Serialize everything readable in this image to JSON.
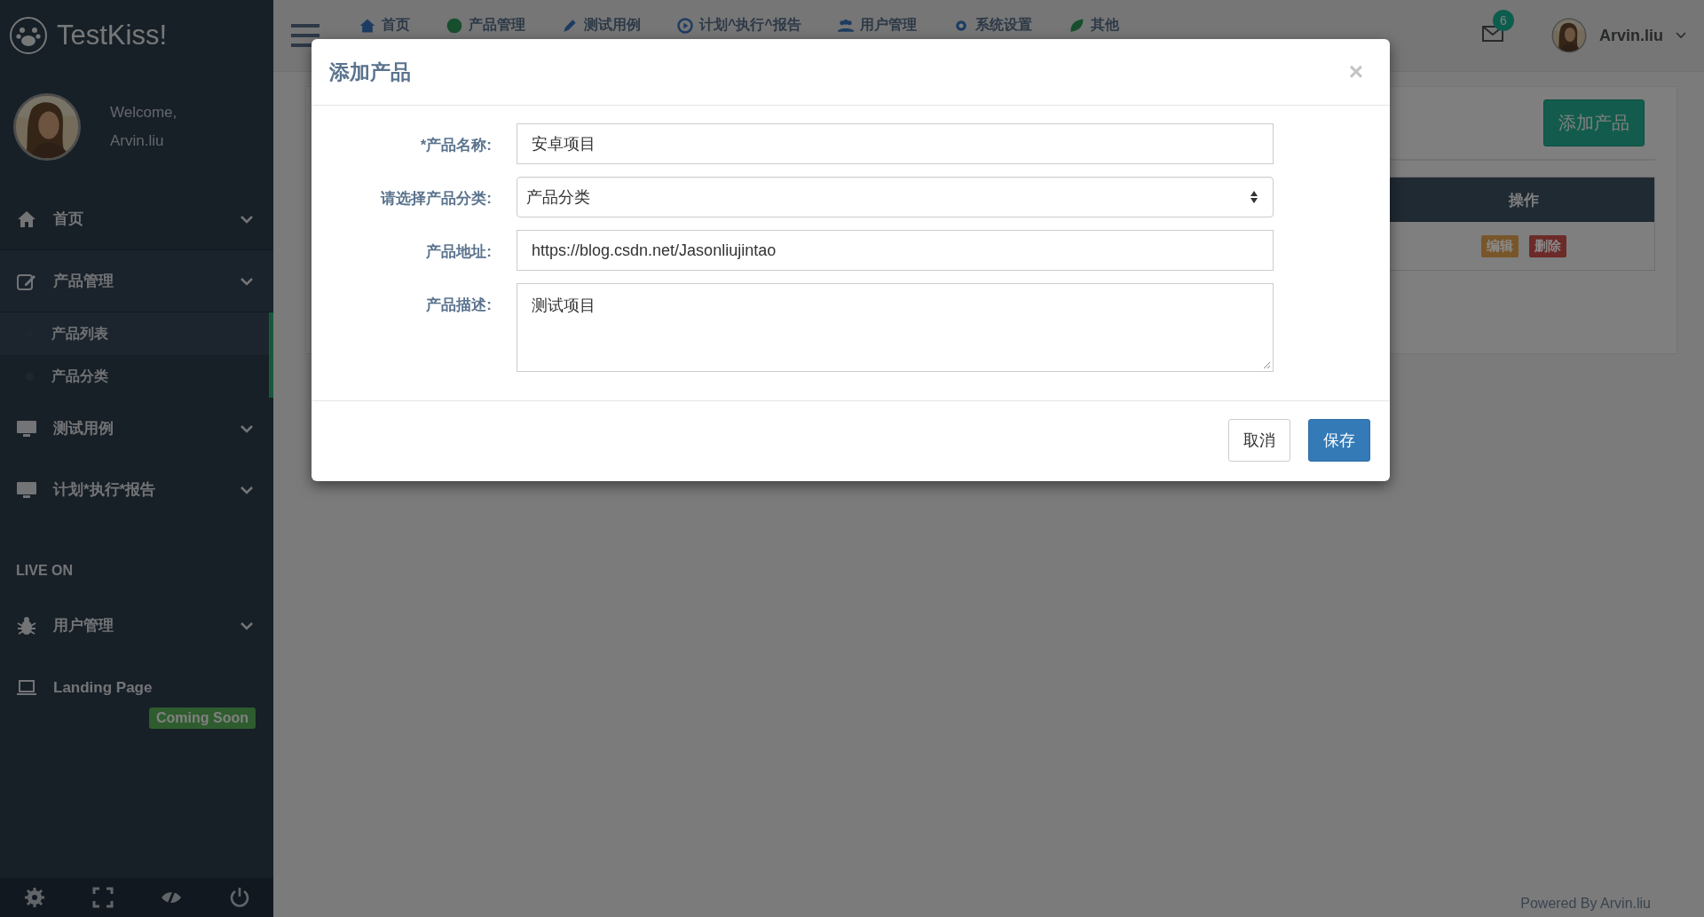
{
  "brand": {
    "name": "TestKiss!"
  },
  "profile": {
    "greeting": "Welcome,",
    "name": "Arvin.liu"
  },
  "sidebar": {
    "items": [
      {
        "label": "首页",
        "expanded": false
      },
      {
        "label": "产品管理",
        "expanded": true,
        "children": [
          {
            "label": "产品列表",
            "selected": true
          },
          {
            "label": "产品分类",
            "selected": false
          }
        ]
      },
      {
        "label": "测试用例",
        "expanded": false
      },
      {
        "label": "计划*执行*报告",
        "expanded": false
      }
    ],
    "section_title": "LIVE ON",
    "section_items": [
      {
        "label": "用户管理",
        "kind": "menu"
      },
      {
        "label": "Landing Page",
        "kind": "link",
        "badge": "Coming Soon"
      }
    ]
  },
  "topnav": [
    "首页",
    "产品管理",
    "测试用例",
    "计划^执行^报告",
    "用户管理",
    "系统设置",
    "其他"
  ],
  "header": {
    "mail_count": "6",
    "user": "Arvin.liu"
  },
  "content": {
    "add_button": "添加产品",
    "table": {
      "columns": [
        "操作"
      ],
      "rows": [
        {
          "actions": [
            {
              "label": "编辑",
              "color": "#78562a"
            },
            {
              "label": "删除",
              "color": "#6c2a28"
            }
          ]
        }
      ]
    }
  },
  "footer": "Powered By Arvin.liu",
  "modal": {
    "title": "添加产品",
    "close": "×",
    "fields": [
      {
        "label": "*产品名称:",
        "kind": "text",
        "value": "安卓项目"
      },
      {
        "label": "请选择产品分类:",
        "kind": "select",
        "value": "产品分类"
      },
      {
        "label": "产品地址:",
        "kind": "text",
        "value": "https://blog.csdn.net/Jasonliujintao"
      },
      {
        "label": "产品描述:",
        "kind": "textarea",
        "value": "测试项目"
      }
    ],
    "buttons": [
      {
        "label": "取消",
        "kind": "default"
      },
      {
        "label": "保存",
        "kind": "primary"
      }
    ]
  }
}
